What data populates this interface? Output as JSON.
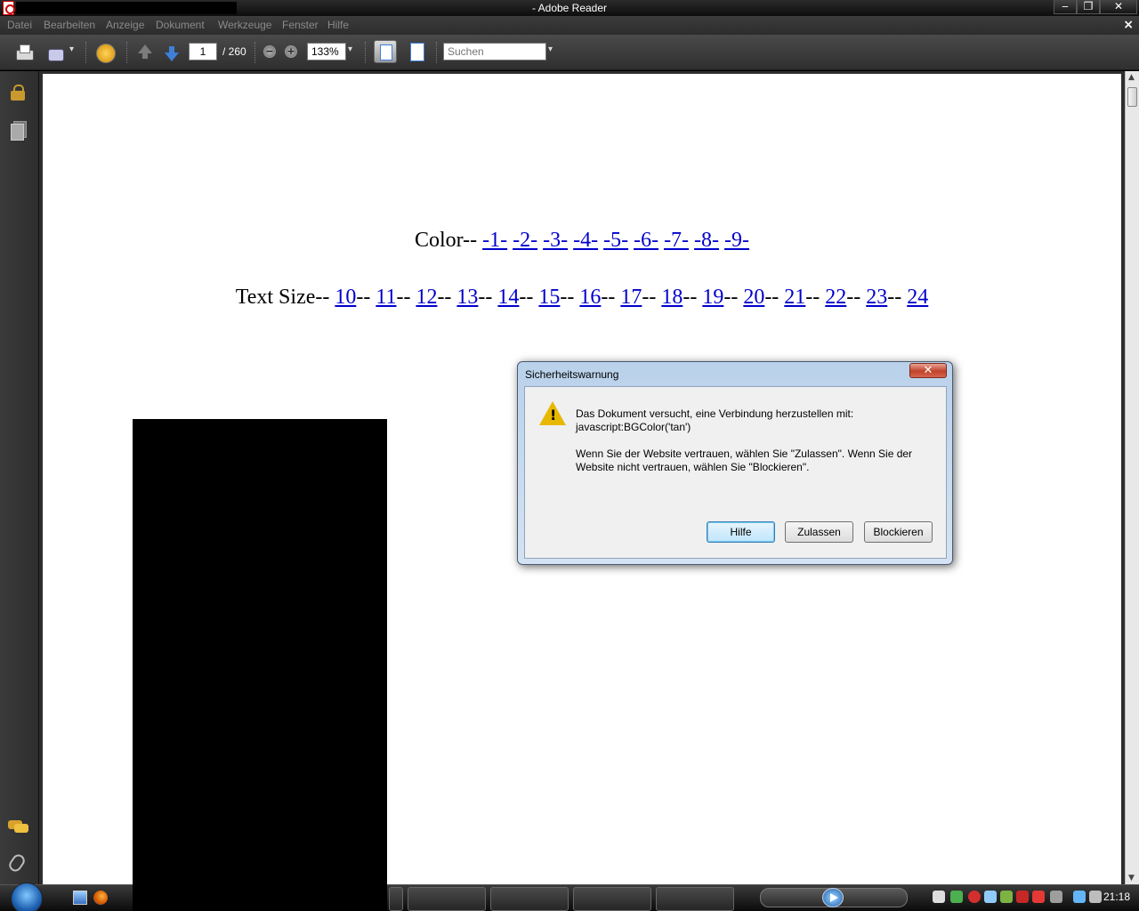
{
  "window": {
    "title": "- Adobe Reader",
    "buttons": {
      "minimize": "‒",
      "restore": "❐",
      "close": "✕"
    }
  },
  "menu": {
    "items": [
      "Datei",
      "Bearbeiten",
      "Anzeige",
      "Dokument",
      "Werkzeuge",
      "Fenster",
      "Hilfe"
    ],
    "doc_close": "×"
  },
  "toolbar": {
    "page_current": "1",
    "page_total": "/ 260",
    "zoom": "133%",
    "zoom_out": "−",
    "zoom_in": "+",
    "search_placeholder": "Suchen"
  },
  "document": {
    "color_label": "Color-- ",
    "color_links": [
      "-1-",
      "-2-",
      "-3-",
      "-4-",
      "-5-",
      "-6-",
      "-7-",
      "-8-",
      "-9-"
    ],
    "textsize_label": "Text Size-- ",
    "textsize_links": [
      "10",
      "11",
      "12",
      "13",
      "14",
      "15",
      "16",
      "17",
      "18",
      "19",
      "20",
      "21",
      "22",
      "23",
      "24"
    ],
    "separator": "-- "
  },
  "dialog": {
    "title": "Sicherheitswarnung",
    "close": "✕",
    "line1": "Das Dokument versucht, eine Verbindung herzustellen mit:",
    "line2": "javascript:BGColor('tan')",
    "line3": "Wenn Sie der Website vertrauen, wählen Sie \"Zulassen\". Wenn Sie der",
    "line4": "Website nicht vertrauen, wählen Sie \"Blockieren\".",
    "btn_help": "Hilfe",
    "btn_allow": "Zulassen",
    "btn_block": "Blockieren"
  },
  "taskbar": {
    "clock": "21:18"
  },
  "colors": {
    "link": "#0000cc",
    "dialog_frame": "#b9d1ea",
    "accent_blue": "#3f7fd8"
  }
}
